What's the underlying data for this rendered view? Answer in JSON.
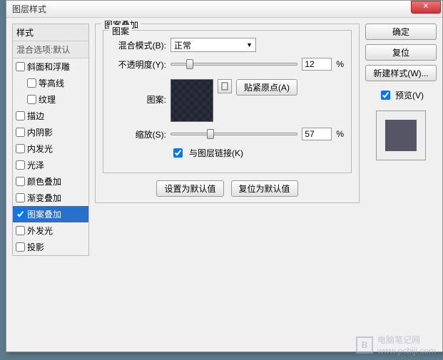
{
  "window": {
    "title": "图层样式",
    "close": "✕"
  },
  "sidebar": {
    "header": "样式",
    "blendHeader": "混合选项:默认",
    "items": [
      {
        "label": "斜面和浮雕",
        "checked": false,
        "indent": false
      },
      {
        "label": "等高线",
        "checked": false,
        "indent": true
      },
      {
        "label": "纹理",
        "checked": false,
        "indent": true
      },
      {
        "label": "描边",
        "checked": false,
        "indent": false
      },
      {
        "label": "内阴影",
        "checked": false,
        "indent": false
      },
      {
        "label": "内发光",
        "checked": false,
        "indent": false
      },
      {
        "label": "光泽",
        "checked": false,
        "indent": false
      },
      {
        "label": "颜色叠加",
        "checked": false,
        "indent": false
      },
      {
        "label": "渐变叠加",
        "checked": false,
        "indent": false
      },
      {
        "label": "图案叠加",
        "checked": true,
        "indent": false,
        "selected": true
      },
      {
        "label": "外发光",
        "checked": false,
        "indent": false
      },
      {
        "label": "投影",
        "checked": false,
        "indent": false
      }
    ]
  },
  "main": {
    "groupTitle": "图案叠加",
    "innerTitle": "图案",
    "blendMode": {
      "label": "混合模式(B):",
      "value": "正常"
    },
    "opacity": {
      "label": "不透明度(Y):",
      "value": "12",
      "pct": "%",
      "pos": 12
    },
    "pattern": {
      "label": "图案:",
      "snap": "贴紧原点(A)"
    },
    "scale": {
      "label": "缩放(S):",
      "value": "57",
      "pct": "%",
      "pos": 57
    },
    "link": {
      "label": "与图层链接(K)",
      "checked": true
    },
    "defaults": {
      "set": "设置为默认值",
      "reset": "复位为默认值"
    }
  },
  "right": {
    "ok": "确定",
    "cancel": "复位",
    "newStyle": "新建样式(W)...",
    "preview": {
      "label": "预览(V)",
      "checked": true
    }
  },
  "watermark": {
    "line1": "电脑笔记网",
    "line2": "www.pcbiji.com",
    "logo": "B"
  }
}
